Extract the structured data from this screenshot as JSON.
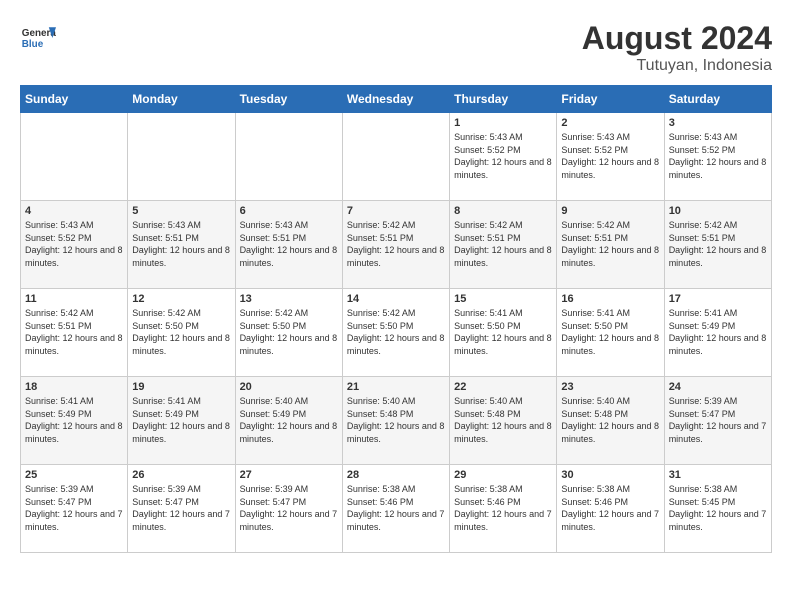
{
  "header": {
    "logo_general": "General",
    "logo_blue": "Blue",
    "month_year": "August 2024",
    "location": "Tutuyan, Indonesia"
  },
  "days_of_week": [
    "Sunday",
    "Monday",
    "Tuesday",
    "Wednesday",
    "Thursday",
    "Friday",
    "Saturday"
  ],
  "weeks": [
    [
      {
        "day": "",
        "sunrise": "",
        "sunset": "",
        "daylight": ""
      },
      {
        "day": "",
        "sunrise": "",
        "sunset": "",
        "daylight": ""
      },
      {
        "day": "",
        "sunrise": "",
        "sunset": "",
        "daylight": ""
      },
      {
        "day": "",
        "sunrise": "",
        "sunset": "",
        "daylight": ""
      },
      {
        "day": "1",
        "sunrise": "Sunrise: 5:43 AM",
        "sunset": "Sunset: 5:52 PM",
        "daylight": "Daylight: 12 hours and 8 minutes."
      },
      {
        "day": "2",
        "sunrise": "Sunrise: 5:43 AM",
        "sunset": "Sunset: 5:52 PM",
        "daylight": "Daylight: 12 hours and 8 minutes."
      },
      {
        "day": "3",
        "sunrise": "Sunrise: 5:43 AM",
        "sunset": "Sunset: 5:52 PM",
        "daylight": "Daylight: 12 hours and 8 minutes."
      }
    ],
    [
      {
        "day": "4",
        "sunrise": "Sunrise: 5:43 AM",
        "sunset": "Sunset: 5:52 PM",
        "daylight": "Daylight: 12 hours and 8 minutes."
      },
      {
        "day": "5",
        "sunrise": "Sunrise: 5:43 AM",
        "sunset": "Sunset: 5:51 PM",
        "daylight": "Daylight: 12 hours and 8 minutes."
      },
      {
        "day": "6",
        "sunrise": "Sunrise: 5:43 AM",
        "sunset": "Sunset: 5:51 PM",
        "daylight": "Daylight: 12 hours and 8 minutes."
      },
      {
        "day": "7",
        "sunrise": "Sunrise: 5:42 AM",
        "sunset": "Sunset: 5:51 PM",
        "daylight": "Daylight: 12 hours and 8 minutes."
      },
      {
        "day": "8",
        "sunrise": "Sunrise: 5:42 AM",
        "sunset": "Sunset: 5:51 PM",
        "daylight": "Daylight: 12 hours and 8 minutes."
      },
      {
        "day": "9",
        "sunrise": "Sunrise: 5:42 AM",
        "sunset": "Sunset: 5:51 PM",
        "daylight": "Daylight: 12 hours and 8 minutes."
      },
      {
        "day": "10",
        "sunrise": "Sunrise: 5:42 AM",
        "sunset": "Sunset: 5:51 PM",
        "daylight": "Daylight: 12 hours and 8 minutes."
      }
    ],
    [
      {
        "day": "11",
        "sunrise": "Sunrise: 5:42 AM",
        "sunset": "Sunset: 5:51 PM",
        "daylight": "Daylight: 12 hours and 8 minutes."
      },
      {
        "day": "12",
        "sunrise": "Sunrise: 5:42 AM",
        "sunset": "Sunset: 5:50 PM",
        "daylight": "Daylight: 12 hours and 8 minutes."
      },
      {
        "day": "13",
        "sunrise": "Sunrise: 5:42 AM",
        "sunset": "Sunset: 5:50 PM",
        "daylight": "Daylight: 12 hours and 8 minutes."
      },
      {
        "day": "14",
        "sunrise": "Sunrise: 5:42 AM",
        "sunset": "Sunset: 5:50 PM",
        "daylight": "Daylight: 12 hours and 8 minutes."
      },
      {
        "day": "15",
        "sunrise": "Sunrise: 5:41 AM",
        "sunset": "Sunset: 5:50 PM",
        "daylight": "Daylight: 12 hours and 8 minutes."
      },
      {
        "day": "16",
        "sunrise": "Sunrise: 5:41 AM",
        "sunset": "Sunset: 5:50 PM",
        "daylight": "Daylight: 12 hours and 8 minutes."
      },
      {
        "day": "17",
        "sunrise": "Sunrise: 5:41 AM",
        "sunset": "Sunset: 5:49 PM",
        "daylight": "Daylight: 12 hours and 8 minutes."
      }
    ],
    [
      {
        "day": "18",
        "sunrise": "Sunrise: 5:41 AM",
        "sunset": "Sunset: 5:49 PM",
        "daylight": "Daylight: 12 hours and 8 minutes."
      },
      {
        "day": "19",
        "sunrise": "Sunrise: 5:41 AM",
        "sunset": "Sunset: 5:49 PM",
        "daylight": "Daylight: 12 hours and 8 minutes."
      },
      {
        "day": "20",
        "sunrise": "Sunrise: 5:40 AM",
        "sunset": "Sunset: 5:49 PM",
        "daylight": "Daylight: 12 hours and 8 minutes."
      },
      {
        "day": "21",
        "sunrise": "Sunrise: 5:40 AM",
        "sunset": "Sunset: 5:48 PM",
        "daylight": "Daylight: 12 hours and 8 minutes."
      },
      {
        "day": "22",
        "sunrise": "Sunrise: 5:40 AM",
        "sunset": "Sunset: 5:48 PM",
        "daylight": "Daylight: 12 hours and 8 minutes."
      },
      {
        "day": "23",
        "sunrise": "Sunrise: 5:40 AM",
        "sunset": "Sunset: 5:48 PM",
        "daylight": "Daylight: 12 hours and 8 minutes."
      },
      {
        "day": "24",
        "sunrise": "Sunrise: 5:39 AM",
        "sunset": "Sunset: 5:47 PM",
        "daylight": "Daylight: 12 hours and 7 minutes."
      }
    ],
    [
      {
        "day": "25",
        "sunrise": "Sunrise: 5:39 AM",
        "sunset": "Sunset: 5:47 PM",
        "daylight": "Daylight: 12 hours and 7 minutes."
      },
      {
        "day": "26",
        "sunrise": "Sunrise: 5:39 AM",
        "sunset": "Sunset: 5:47 PM",
        "daylight": "Daylight: 12 hours and 7 minutes."
      },
      {
        "day": "27",
        "sunrise": "Sunrise: 5:39 AM",
        "sunset": "Sunset: 5:47 PM",
        "daylight": "Daylight: 12 hours and 7 minutes."
      },
      {
        "day": "28",
        "sunrise": "Sunrise: 5:38 AM",
        "sunset": "Sunset: 5:46 PM",
        "daylight": "Daylight: 12 hours and 7 minutes."
      },
      {
        "day": "29",
        "sunrise": "Sunrise: 5:38 AM",
        "sunset": "Sunset: 5:46 PM",
        "daylight": "Daylight: 12 hours and 7 minutes."
      },
      {
        "day": "30",
        "sunrise": "Sunrise: 5:38 AM",
        "sunset": "Sunset: 5:46 PM",
        "daylight": "Daylight: 12 hours and 7 minutes."
      },
      {
        "day": "31",
        "sunrise": "Sunrise: 5:38 AM",
        "sunset": "Sunset: 5:45 PM",
        "daylight": "Daylight: 12 hours and 7 minutes."
      }
    ]
  ]
}
